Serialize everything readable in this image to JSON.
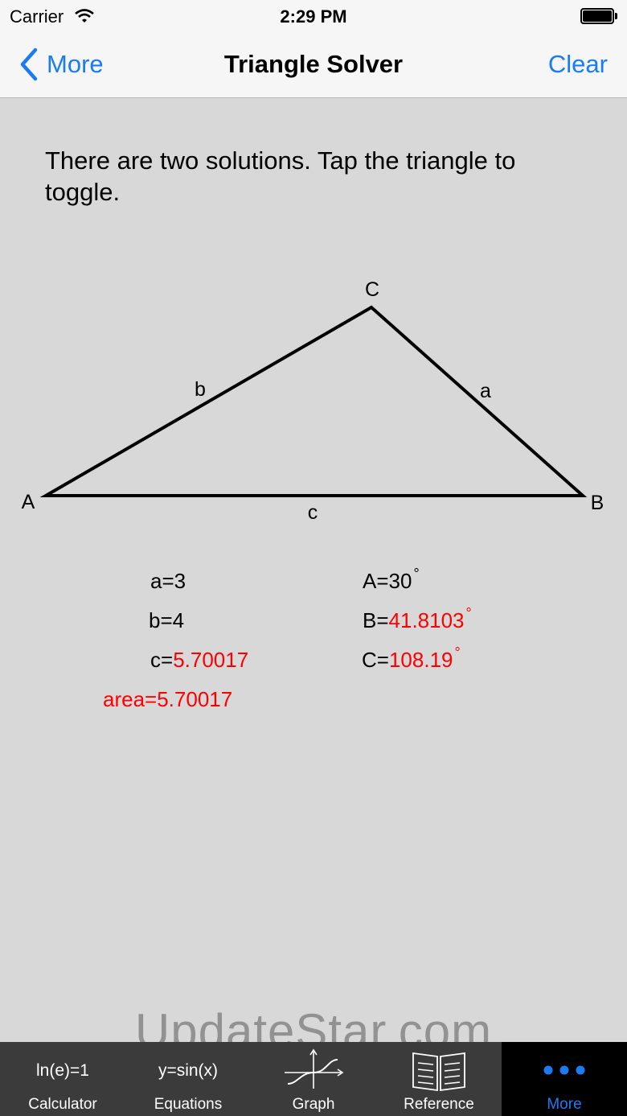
{
  "status_bar": {
    "carrier": "Carrier",
    "time": "2:29 PM"
  },
  "nav": {
    "back_label": "More",
    "title": "Triangle Solver",
    "clear_label": "Clear"
  },
  "message": "There are two solutions.  Tap the triangle to toggle.",
  "triangle": {
    "vertices": {
      "A": "A",
      "B": "B",
      "C": "C"
    },
    "sides": {
      "a": "a",
      "b": "b",
      "c": "c"
    }
  },
  "values": {
    "a": {
      "label": "a=",
      "value": "3"
    },
    "b": {
      "label": "b=",
      "value": "4"
    },
    "c": {
      "label": "c=",
      "value": "5.70017"
    },
    "A": {
      "label": "A=",
      "value": "30",
      "unit": "°"
    },
    "B": {
      "label": "B=",
      "value": "41.8103",
      "unit": "°"
    },
    "C": {
      "label": "C=",
      "value": "108.19",
      "unit": "°"
    },
    "area": "area=5.70017"
  },
  "colors": {
    "accent": "#1a7cf5",
    "computed": "#ff0000",
    "tab_bar": "#3b3b3b"
  },
  "watermark": "UpdateStar.com",
  "tabs": [
    {
      "top": "ln(e)=1",
      "label": "Calculator",
      "icon": null
    },
    {
      "top": "y=sin(x)",
      "label": "Equations",
      "icon": null
    },
    {
      "top": null,
      "label": "Graph",
      "icon": "graph-icon"
    },
    {
      "top": null,
      "label": "Reference",
      "icon": "book-icon"
    },
    {
      "top": null,
      "label": "More",
      "icon": "more-dots-icon"
    }
  ],
  "active_tab": 4
}
